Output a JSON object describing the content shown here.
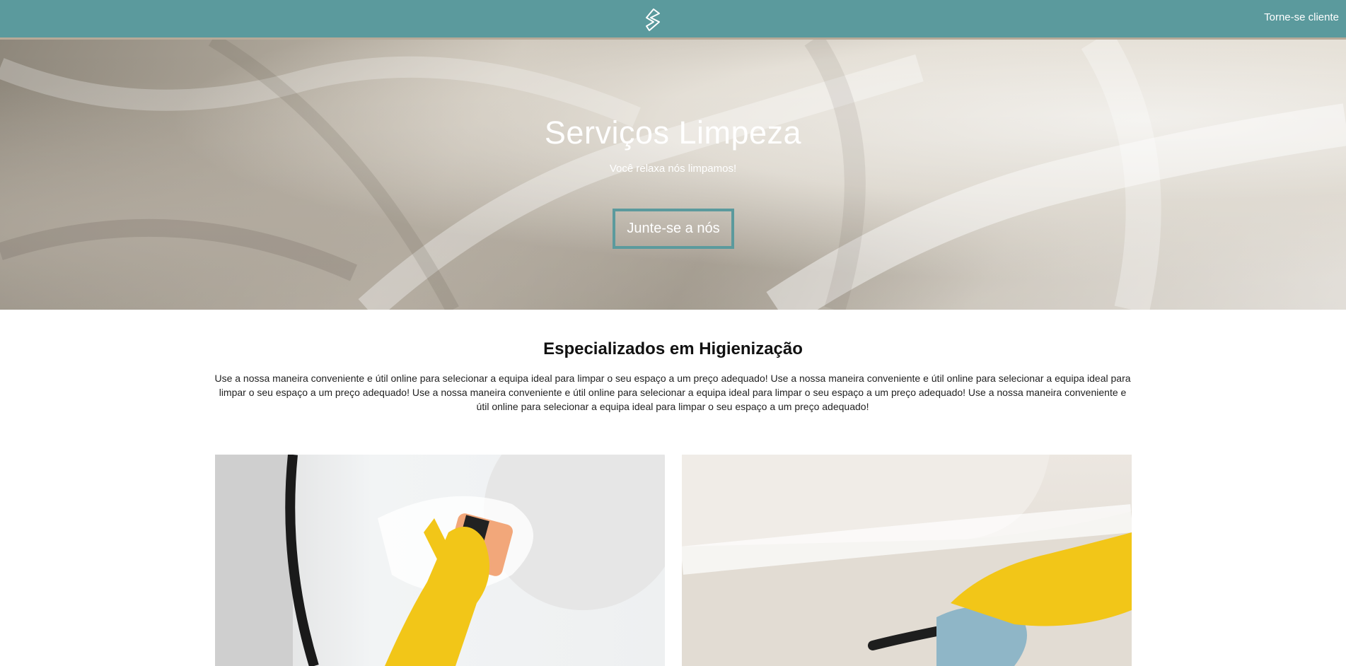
{
  "header": {
    "logo_icon": "stylized-s-logo-icon",
    "cta_label": "Torne-se cliente"
  },
  "hero": {
    "title": "Serviços Limpeza",
    "subtitle": "Você relaxa nós limpamos!",
    "button_label": "Junte-se a nós"
  },
  "intro": {
    "title": "Especializados em Higienização",
    "text": "Use a nossa maneira conveniente e útil online para selecionar a equipa ideal para limpar o seu espaço a um preço adequado! Use a nossa maneira conveniente e útil online para selecionar a equipa ideal para limpar o seu espaço a um preço adequado! Use a nossa maneira conveniente e útil online para selecionar a equipa ideal para limpar o seu espaço a um preço adequado! Use a nossa maneira conveniente e útil online para selecionar a equipa ideal para limpar o seu espaço a um preço adequado!"
  },
  "colors": {
    "brand_teal": "#5b9a9d",
    "glove_yellow": "#f2c618"
  }
}
